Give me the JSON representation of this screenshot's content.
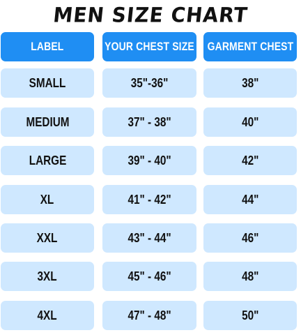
{
  "title": "MEN SIZE CHART",
  "headers": [
    "LABEL",
    "YOUR CHEST SIZE",
    "GARMENT CHEST"
  ],
  "rows": [
    {
      "label": "SMALL",
      "chest": "35\"-36\"",
      "garment": "38\""
    },
    {
      "label": "MEDIUM",
      "chest": "37\" - 38\"",
      "garment": "40\""
    },
    {
      "label": "LARGE",
      "chest": "39\" - 40\"",
      "garment": "42\""
    },
    {
      "label": "XL",
      "chest": "41\" - 42\"",
      "garment": "44\""
    },
    {
      "label": "XXL",
      "chest": "43\" - 44\"",
      "garment": "46\""
    },
    {
      "label": "3XL",
      "chest": "45\" - 46\"",
      "garment": "48\""
    },
    {
      "label": "4XL",
      "chest": "47\" - 48\"",
      "garment": "50\""
    }
  ],
  "colors": {
    "header_bg": "#1f8ef3",
    "header_text": "#ffffff",
    "row_bg": "#cfe8ff",
    "row_text": "#111111",
    "title_text": "#111111"
  }
}
